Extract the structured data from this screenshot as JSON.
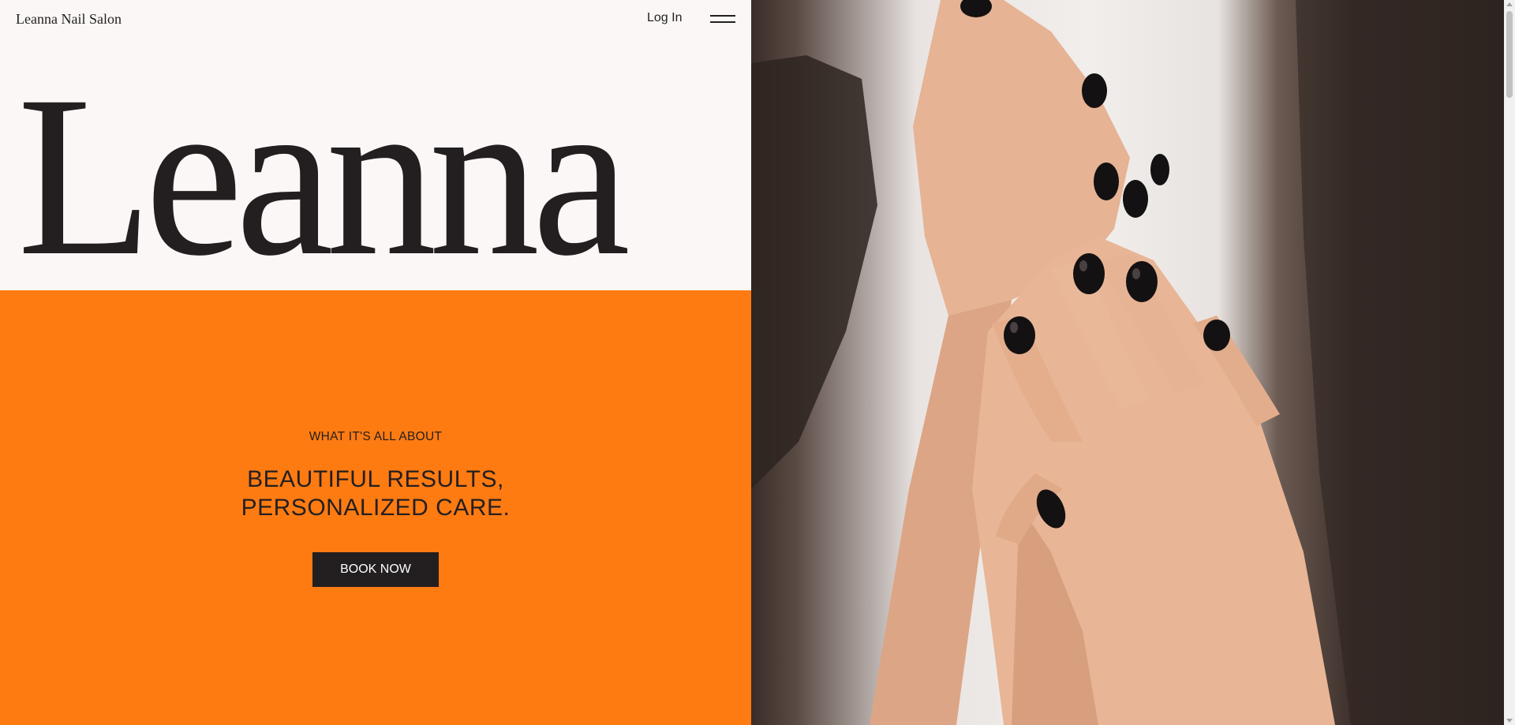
{
  "header": {
    "site_name": "Leanna Nail Salon",
    "login_label": "Log In",
    "menu_icon": "hamburger-menu-icon"
  },
  "hero": {
    "word": "Leanna"
  },
  "about": {
    "eyebrow": "WHAT IT'S ALL ABOUT",
    "headline_line1": "BEAUTIFUL RESULTS,",
    "headline_line2": "PERSONALIZED CARE.",
    "book_label": "BOOK NOW"
  },
  "colors": {
    "background": "#faf7f6",
    "accent_orange": "#fe7b12",
    "dark": "#231f20",
    "button_text": "#ffffff"
  },
  "photo": {
    "subject": "hands-with-black-nail-polish"
  }
}
